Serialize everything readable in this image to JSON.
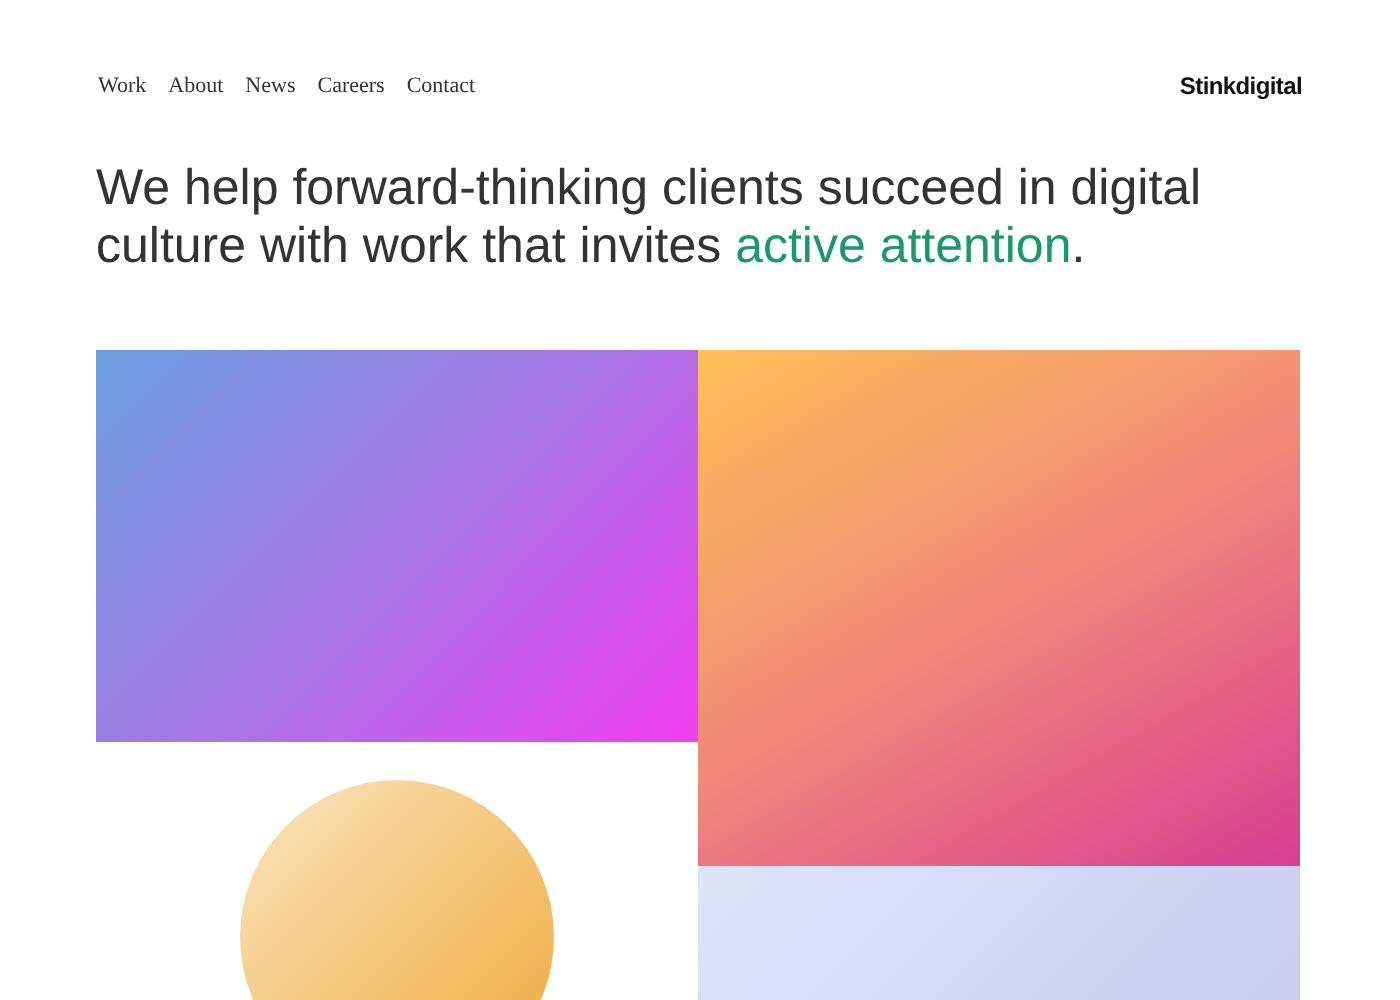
{
  "nav": {
    "items": [
      "Work",
      "About",
      "News",
      "Careers",
      "Contact"
    ]
  },
  "logo": "Stinkdigital",
  "headline": {
    "text": "We help forward-thinking clients succeed in digital culture with work that invites ",
    "highlight": "active attention",
    "end": "."
  }
}
